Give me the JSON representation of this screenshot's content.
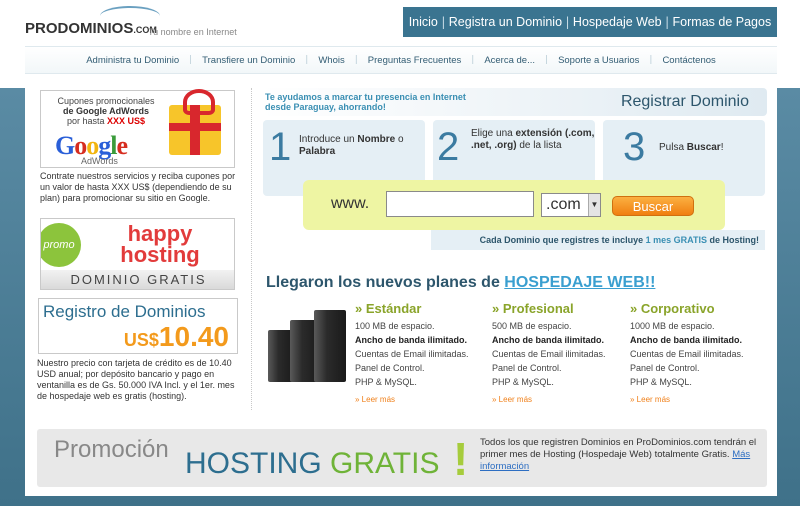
{
  "logo": {
    "name": "PRODOMINIOS",
    "suffix": ".COM",
    "tagline": "Tu nombre en Internet"
  },
  "topnav": [
    "Inicio",
    "Registra un Dominio",
    "Hospedaje Web",
    "Formas de Pagos"
  ],
  "subnav": [
    "Administra tu Dominio",
    "Transfiere un Dominio",
    "Whois",
    "Preguntas Frecuentes",
    "Acerca de...",
    "Soporte a Usuarios",
    "Contáctenos"
  ],
  "left": {
    "adwords": {
      "line1": "Cupones promocionales",
      "line2": "de Google AdWords",
      "line3_pre": "por hasta ",
      "line3_hl": "XXX US$",
      "brand": [
        "G",
        "o",
        "o",
        "g",
        "l",
        "e"
      ],
      "sub": "AdWords",
      "desc": "Contrate nuestros servicios y reciba cupones por un valor de hasta XXX US$ (dependiendo de su plan) para promocionar su sitio en Google."
    },
    "happy": {
      "badge": "promo",
      "title1": "happy",
      "title2": "hosting",
      "subtitle": "DOMINIO GRATIS"
    },
    "registro": {
      "title": "Registro de Dominios",
      "currency": "US$",
      "price": "10.40",
      "desc": "Nuestro precio con tarjeta de crédito es de 10.40 USD anual; por depósito bancario y pago en ventanilla es de Gs. 50.000 IVA Incl. y el 1er. mes de hospedaje web es gratis (hosting)."
    }
  },
  "panel": {
    "intro": "Te ayudamos a marcar tu presencia en Internet desde Paraguay, ahorrando!",
    "title": "Registrar Dominio",
    "steps": [
      {
        "num": "1",
        "pre": "Introduce un ",
        "b1": "Nombre",
        "mid": " o ",
        "b2": "Palabra",
        "post": ""
      },
      {
        "num": "2",
        "pre": "Elige una ",
        "b1": "extensión (.com, .net, .org)",
        "mid": " de la lista",
        "b2": "",
        "post": ""
      },
      {
        "num": "3",
        "pre": "Pulsa ",
        "b1": "Buscar",
        "mid": "!",
        "b2": "",
        "post": ""
      }
    ],
    "www": "www.",
    "domain_value": "",
    "tld_value": ".com",
    "button": "Buscar",
    "foot_pre": "Cada Dominio que registres te incluye ",
    "foot_hl": "1 mes GRATIS",
    "foot_post": " de Hosting!"
  },
  "plans": {
    "title_pre": "Llegaron los nuevos planes de ",
    "title_link": "HOSPEDAJE WEB!!",
    "items": [
      {
        "name": "» Estándar",
        "features": [
          "100 MB de espacio.",
          "Ancho de banda ilimitado.",
          "Cuentas de Email ilimitadas.",
          "Panel de Control.",
          "PHP & MySQL."
        ],
        "more": "» Leer más"
      },
      {
        "name": "» Profesional",
        "features": [
          "500 MB de espacio.",
          "Ancho de banda ilimitado.",
          "Cuentas de Email ilimitadas.",
          "Panel de Control.",
          "PHP & MySQL."
        ],
        "more": "» Leer más"
      },
      {
        "name": "» Corporativo",
        "features": [
          "1000 MB de espacio.",
          "Ancho de banda ilimitado.",
          "Cuentas de Email ilimitadas.",
          "Panel de Control.",
          "PHP & MySQL."
        ],
        "more": "» Leer más"
      }
    ]
  },
  "promo": {
    "line1": "Promoción",
    "hosting": "HOSTING",
    "gratis": "GRATIS",
    "bang": "!",
    "text": "Todos los que registren Dominios en ProDominios.com tendrán el primer mes de Hosting (Hospedaje Web) totalmente Gratis.",
    "link": "Más información"
  }
}
